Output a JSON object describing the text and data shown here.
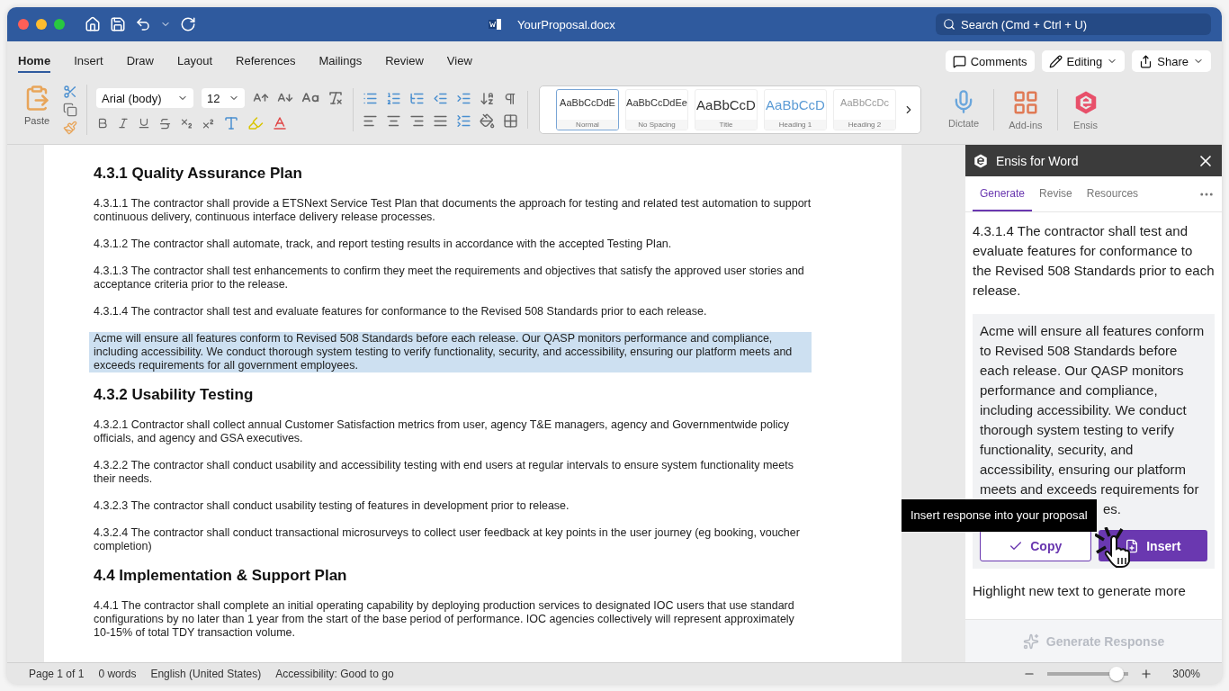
{
  "window": {
    "title": "YourProposal.docx",
    "search": {
      "placeholder": "Search (Cmd + Ctrl + U)"
    }
  },
  "ribbon_tabs": [
    {
      "label": "Home",
      "selected": true
    },
    {
      "label": "Insert",
      "selected": false
    },
    {
      "label": "Draw",
      "selected": false
    },
    {
      "label": "Layout",
      "selected": false
    },
    {
      "label": "References",
      "selected": false
    },
    {
      "label": "Mailings",
      "selected": false
    },
    {
      "label": "Review",
      "selected": false
    },
    {
      "label": "View",
      "selected": false
    }
  ],
  "top_actions": [
    {
      "kind": "comments",
      "label": "Comments"
    },
    {
      "kind": "editing",
      "label": "Editing"
    },
    {
      "kind": "share",
      "label": "Share"
    }
  ],
  "clipboard": {
    "paste_label": "Paste"
  },
  "font": {
    "name": "Arial (body)",
    "size": "12"
  },
  "styles": [
    {
      "sample": "AaBbCcDdE",
      "label": "Normal",
      "kind": "normal",
      "selected": true
    },
    {
      "sample": "AaBbCcDdEe",
      "label": "No Spacing",
      "kind": "normal",
      "selected": false
    },
    {
      "sample": "AaBbCcD",
      "label": "Title",
      "kind": "title",
      "selected": false
    },
    {
      "sample": "AaBbCcD",
      "label": "Heading 1",
      "kind": "heading1",
      "selected": false
    },
    {
      "sample": "AaBbCcDc",
      "label": "Heading 2",
      "kind": "heading2",
      "selected": false
    }
  ],
  "ribbon_apps": [
    {
      "kind": "dictate",
      "label": "Dictate"
    },
    {
      "kind": "addins",
      "label": "Add-ins"
    },
    {
      "kind": "ensis",
      "label": "Ensis"
    }
  ],
  "document": {
    "blocks": [
      {
        "kind": "heading",
        "text": "4.3.1 Quality Assurance Plan"
      },
      {
        "kind": "paragraph",
        "text": "4.3.1.1 The contractor shall provide a ETSNext Service Test Plan that documents the approach for testing and related test automation to support continuous delivery, continuous interface delivery release processes.",
        "highlighted": false
      },
      {
        "kind": "paragraph",
        "text": "4.3.1.2 The contractor shall automate, track, and report testing results in accordance with the accepted Testing Plan.",
        "highlighted": false
      },
      {
        "kind": "paragraph",
        "text": "4.3.1.3 The contractor shall test enhancements to confirm they meet the requirements and objectives that satisfy the approved user stories and acceptance criteria prior to the release.",
        "highlighted": false
      },
      {
        "kind": "paragraph",
        "text": "4.3.1.4 The contractor shall test and evaluate features for conformance to the Revised 508 Standards prior to each release.",
        "highlighted": false
      },
      {
        "kind": "paragraph",
        "text": "Acme will ensure all features conform to Revised 508 Standards before each release. Our QASP monitors performance and compliance, including accessibility. We conduct thorough system testing to verify functionality, security, and accessibility, ensuring our platform meets and exceeds requirements for all government employees.",
        "highlighted": true
      },
      {
        "kind": "heading",
        "text": "4.3.2 Usability Testing"
      },
      {
        "kind": "paragraph",
        "text": "4.3.2.1 Contractor shall collect annual Customer Satisfaction metrics from user, agency T&E managers, agency and Governmentwide policy officials, and agency and GSA executives.",
        "highlighted": false
      },
      {
        "kind": "paragraph",
        "text": "4.3.2.2 The contractor shall conduct usability and accessibility testing with end users at regular intervals to ensure system functionality meets their needs.",
        "highlighted": false
      },
      {
        "kind": "paragraph",
        "text": "4.3.2.3 The contractor shall conduct usability testing of features in development prior to release.",
        "highlighted": false
      },
      {
        "kind": "paragraph",
        "text": "4.3.2.4 The contractor shall conduct transactional microsurveys to collect user feedback at key points in the user journey (eg booking, voucher completion)",
        "highlighted": false
      },
      {
        "kind": "heading",
        "text": "4.4 Implementation & Support Plan"
      },
      {
        "kind": "paragraph",
        "text": "4.4.1 The contractor shall complete an initial operating capability by deploying production services to designated IOC users that use standard configurations by no later than 1 year from the start of the base period of performance. IOC agencies collectively will represent approximately 10-15% of total TDY transaction volume.",
        "highlighted": false
      }
    ]
  },
  "panel": {
    "title": "Ensis for Word",
    "tabs": [
      {
        "label": "Generate",
        "selected": true
      },
      {
        "label": "Revise",
        "selected": false
      },
      {
        "label": "Resources",
        "selected": false
      }
    ],
    "prompt": "4.3.1.4 The contractor shall test and evaluate features for conformance to the Revised 508 Standards prior to each release.",
    "response": {
      "text": "Acme will ensure all features conform to Revised 508 Standards before each release. Our QASP monitors performance and compliance, including accessibility. We conduct thorough system testing to verify functionality, security, and accessibility, ensuring our platform meets and exceeds requirements for",
      "tail": "es."
    },
    "tooltip": "Insert response into your proposal",
    "copy_label": "Copy",
    "insert_label": "Insert",
    "hint": "Highlight new text to generate more",
    "generate": {
      "label": "Generate Response",
      "disabled": true
    }
  },
  "status_bar": {
    "items": [
      "Page 1 of 1",
      "0 words",
      "English (United States)",
      "Accessibility: Good to go"
    ],
    "zoom": {
      "level": 0.82,
      "label": "300%"
    }
  }
}
